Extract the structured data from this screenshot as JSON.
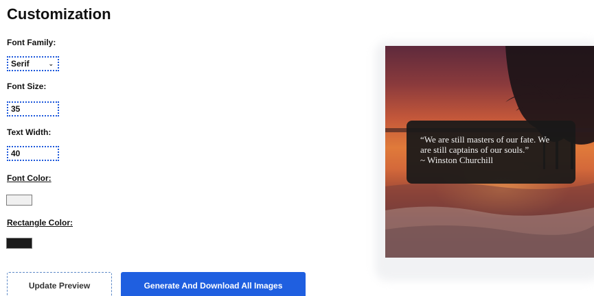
{
  "title": "Customization",
  "font_family": {
    "label": "Font Family:",
    "value": "Serif"
  },
  "font_size": {
    "label": "Font Size:",
    "value": "35"
  },
  "text_width": {
    "label": "Text Width:",
    "value": "40"
  },
  "font_color": {
    "label": "Font Color:",
    "value": "#f0f0f0"
  },
  "rect_color": {
    "label": "Rectangle Color:",
    "value": "#1a1a1a"
  },
  "buttons": {
    "update": "Update Preview",
    "generate": "Generate And Download All Images"
  },
  "preview": {
    "quote_line1": "“We are still masters of our fate. We",
    "quote_line2": "are still captains of our souls.”",
    "author": "~ Winston Churchill"
  },
  "colors": {
    "accent": "#1f5fe0",
    "focus_outline": "#1a56db"
  }
}
